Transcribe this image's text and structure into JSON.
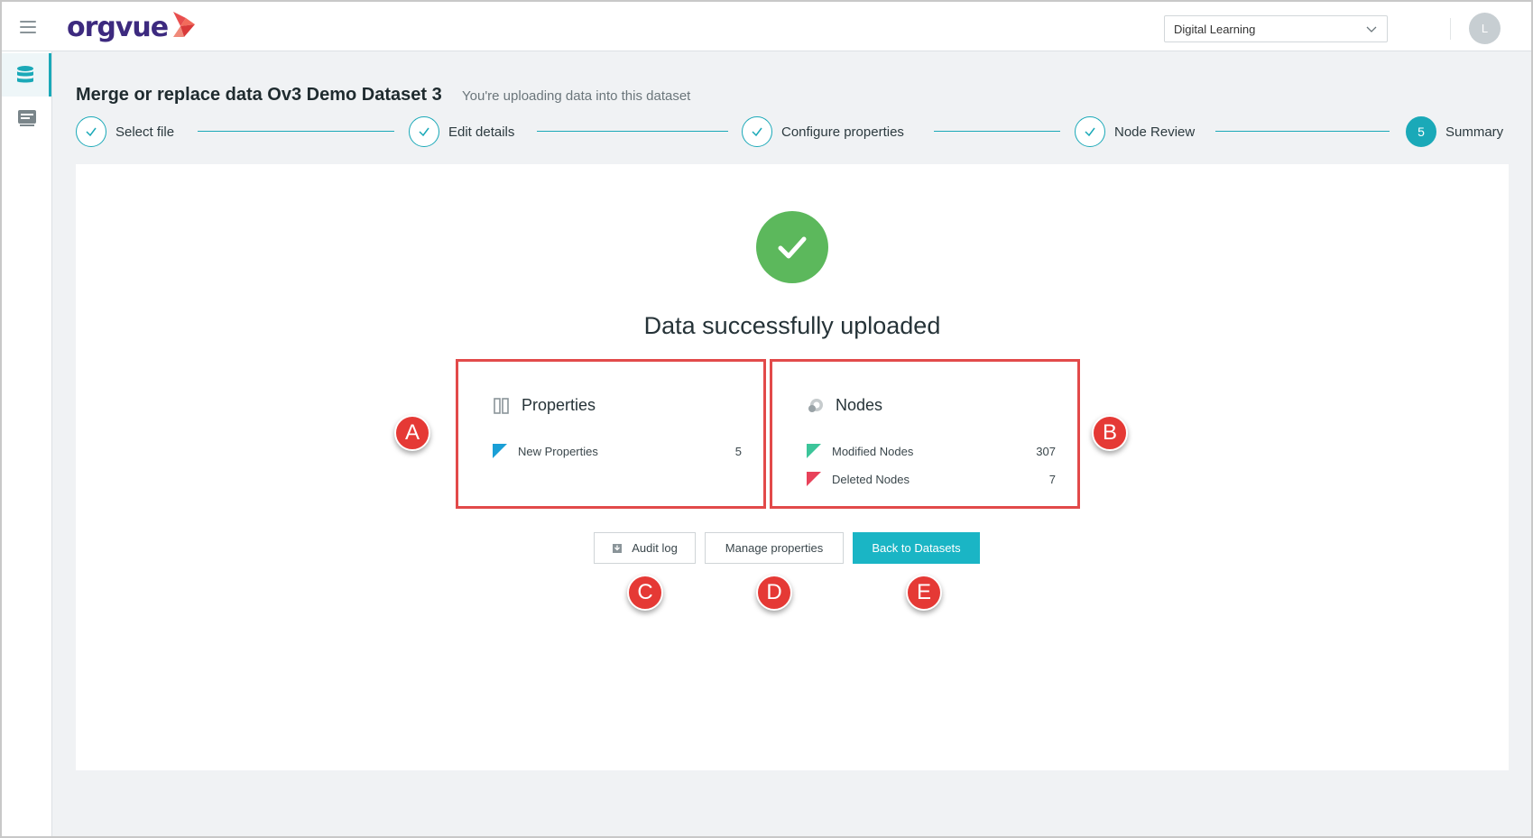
{
  "app": {
    "logo_text": "orgvue",
    "workspace_select": "Digital Learning",
    "avatar_initial": "L"
  },
  "header": {
    "title": "Merge or replace data Ov3 Demo Dataset 3",
    "subtitle": "You're uploading data into this dataset"
  },
  "stepper": {
    "steps": [
      {
        "label": "Select file",
        "state": "done"
      },
      {
        "label": "Edit details",
        "state": "done"
      },
      {
        "label": "Configure properties",
        "state": "done"
      },
      {
        "label": "Node Review",
        "state": "done"
      },
      {
        "label": "Summary",
        "state": "current",
        "number": "5"
      }
    ]
  },
  "main": {
    "success_title": "Data successfully uploaded",
    "properties": {
      "title": "Properties",
      "rows": [
        {
          "label": "New Properties",
          "value": "5",
          "color": "#1a9fd6"
        }
      ]
    },
    "nodes": {
      "title": "Nodes",
      "rows": [
        {
          "label": "Modified Nodes",
          "value": "307",
          "color": "#3cc59a"
        },
        {
          "label": "Deleted Nodes",
          "value": "7",
          "color": "#e8425a"
        }
      ]
    },
    "buttons": {
      "audit_log": "Audit log",
      "manage_properties": "Manage properties",
      "back_to_datasets": "Back to Datasets"
    }
  },
  "annotations": {
    "a": "A",
    "b": "B",
    "c": "C",
    "d": "D",
    "e": "E"
  },
  "colors": {
    "accent": "#1aa9b8",
    "success": "#5cb85c",
    "callout": "#e24a4a"
  }
}
